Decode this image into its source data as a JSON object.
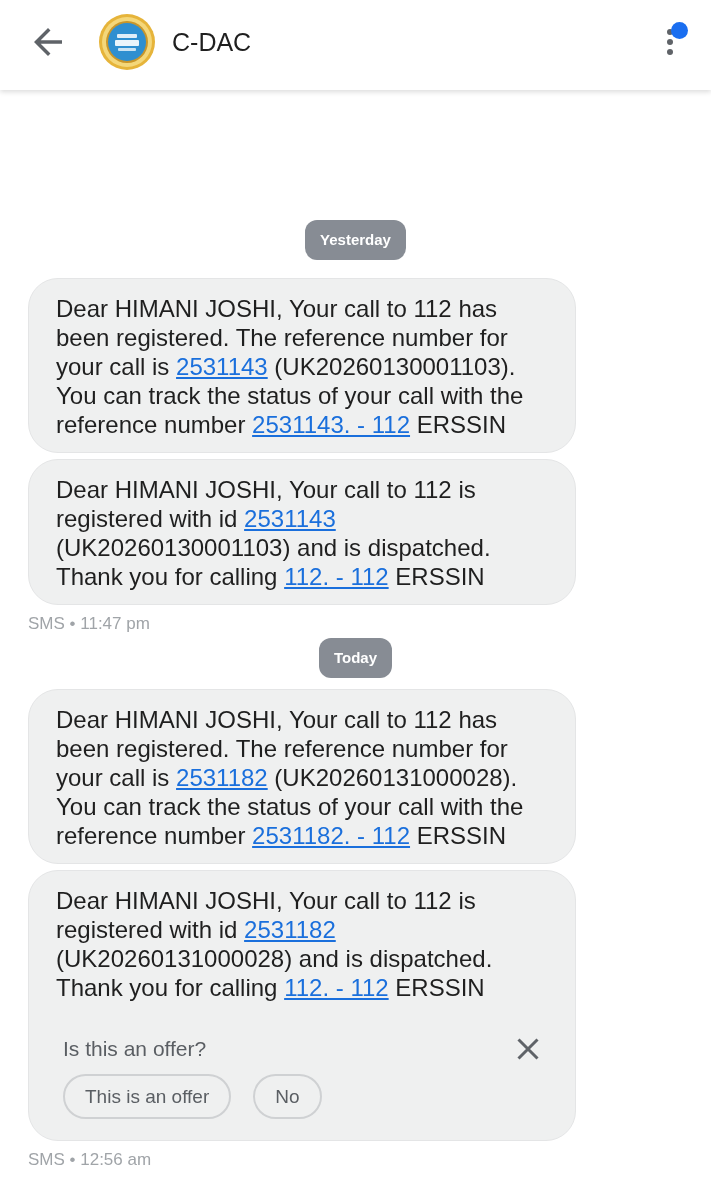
{
  "header": {
    "title": "C-DAC",
    "menu": {
      "badge": true
    }
  },
  "days": [
    {
      "date": "Yesterday",
      "messages": [
        {
          "parts": [
            {
              "kind": "text",
              "text": "Dear HIMANI JOSHI, Your call to 112 has been registered. The reference number for your call is "
            },
            {
              "kind": "link",
              "text": "2531143"
            },
            {
              "kind": "text",
              "text": " (UK20260130001103). You can track the status of your call with the reference number "
            },
            {
              "kind": "link",
              "text": "2531143. - 112"
            },
            {
              "kind": "text",
              "text": " ERSSIN"
            }
          ]
        },
        {
          "parts": [
            {
              "kind": "text",
              "text": "Dear HIMANI JOSHI, Your call to 112 is registered with id "
            },
            {
              "kind": "link",
              "text": "2531143"
            },
            {
              "kind": "text",
              "text": " (UK20260130001103) and is dispatched. Thank you for calling "
            },
            {
              "kind": "link",
              "text": "112. - 112"
            },
            {
              "kind": "text",
              "text": " ERSSIN"
            }
          ]
        }
      ],
      "footer": "SMS • 11:47 pm"
    },
    {
      "date": "Today",
      "messages": [
        {
          "parts": [
            {
              "kind": "text",
              "text": "Dear HIMANI JOSHI, Your call to 112 has been registered. The reference number for your call is "
            },
            {
              "kind": "link",
              "text": "2531182"
            },
            {
              "kind": "text",
              "text": " (UK20260131000028). You can track the status of your call with the reference number "
            },
            {
              "kind": "link",
              "text": "2531182. - 112"
            },
            {
              "kind": "text",
              "text": " ERSSIN"
            }
          ]
        },
        {
          "parts": [
            {
              "kind": "text",
              "text": "Dear HIMANI JOSHI, Your call to 112 is registered with id "
            },
            {
              "kind": "link",
              "text": "2531182"
            },
            {
              "kind": "text",
              "text": " (UK20260131000028) and is dispatched. Thank you for calling "
            },
            {
              "kind": "link",
              "text": "112. - 112"
            },
            {
              "kind": "text",
              "text": " ERSSIN"
            }
          ],
          "offer_prompt": {
            "question": "Is this an offer?",
            "buttons": [
              "This is an offer",
              "No"
            ]
          }
        }
      ],
      "footer": "SMS • 12:56 am"
    }
  ]
}
